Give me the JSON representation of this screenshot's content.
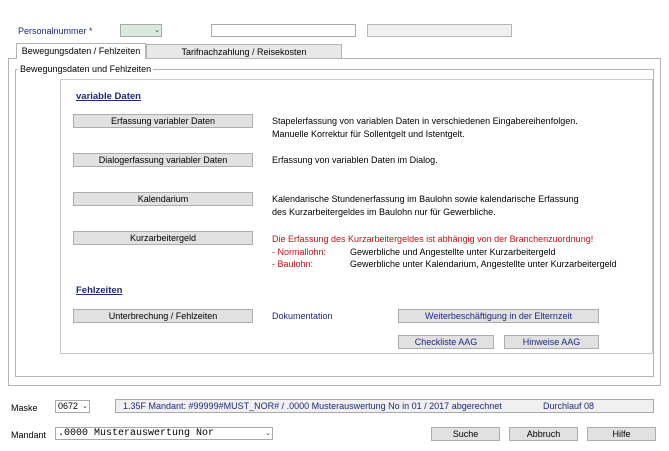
{
  "header": {
    "personal_label": "Personalnummer *"
  },
  "tabs": [
    {
      "label": "Bewegungsdaten / Fehlzeiten"
    },
    {
      "label": "Tarifnachzahlung / Reisekosten"
    }
  ],
  "group": {
    "legend": "Bewegungsdaten und Fehlzeiten",
    "variable_title": "variable Daten",
    "fehlzeiten_title": "Fehlzeiten"
  },
  "buttons": {
    "erfassung": "Erfassung variabler Daten",
    "dialog": "Dialogerfassung variabler Daten",
    "kalendarium": "Kalendarium",
    "kurzarbeit": "Kurzarbeitergeld",
    "unterbrechung": "Unterbrechung / Fehlzeiten",
    "weiterbeschaeftigung": "Weiterbeschäftigung in der Elternzeit",
    "checkliste": "Checkliste AAG",
    "hinweise": "Hinweise AAG"
  },
  "descriptions": {
    "erfassung_1": "Stapelerfassung von variablen Daten in verschiedenen Eingabereihenfolgen.",
    "erfassung_2": "Manuelle Korrektur für Sollentgelt und Istentgelt.",
    "dialog": "Erfassung von variablen Daten im Dialog.",
    "kalendarium_1": "Kalendarische Stundenerfassung im Baulohn sowie kalendarische Erfassung",
    "kalendarium_2": "des Kurzarbeitergeldes im Baulohn nur für Gewerbliche.",
    "kurzarbeit_warning": "Die Erfassung des Kurzarbeitergeldes ist abhängig von der Branchenzuordnung!",
    "normallohn_label": "- Normallohn:",
    "normallohn_text": "Gewerbliche und Angestellte unter Kurzarbeitergeld",
    "baulohn_label": "- Baulohn:",
    "baulohn_text": "Gewerbliche unter Kalendarium, Angestellte unter Kurzarbeitergeld",
    "dokumentation": "Dokumentation"
  },
  "footer": {
    "maske_label": "Maske",
    "maske_value": "0672",
    "status_text": "1.35F Mandant: #99999#MUST_NOR# / .0000 Musterauswertung No in 01 / 2017 abgerechnet",
    "durchlauf": "Durchlauf 08",
    "mandant_label": "Mandant",
    "mandant_value": ".0000 Musterauswertung Nor",
    "suche": "Suche",
    "abbruch": "Abbruch",
    "hilfe": "Hilfe"
  }
}
